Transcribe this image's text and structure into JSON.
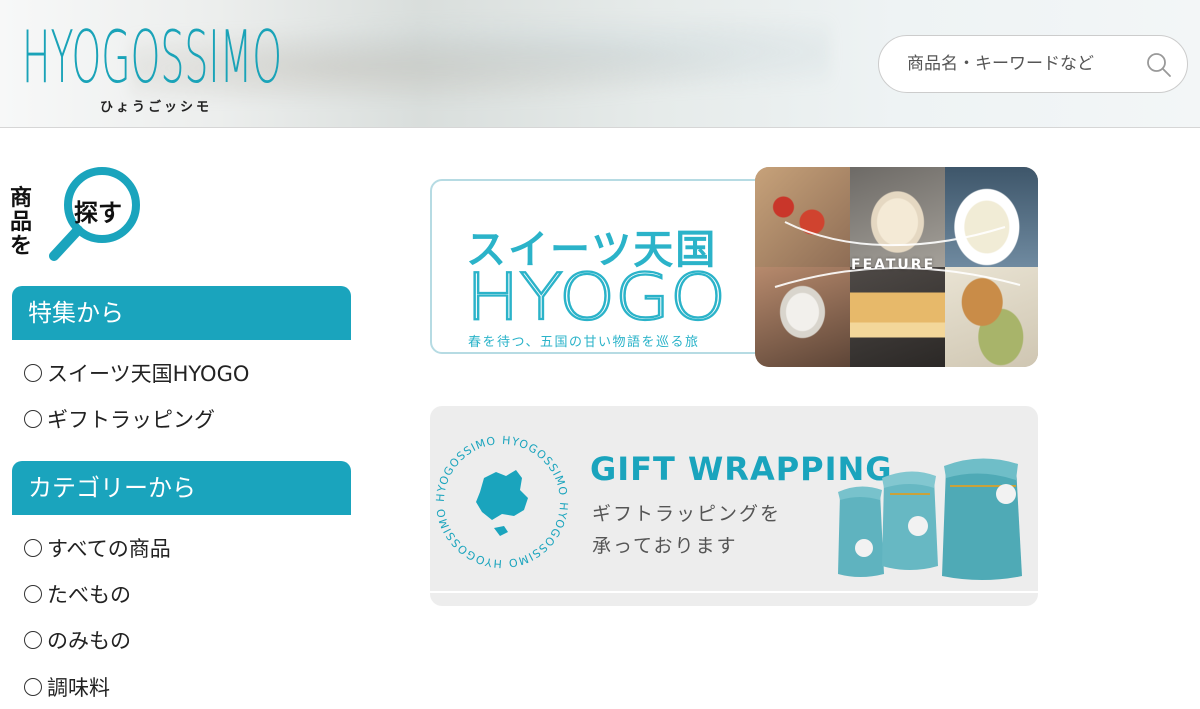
{
  "header": {
    "logo_text": "HYOGOSSIMO",
    "logo_kana": "ひょうごッシモ",
    "search": {
      "placeholder": "商品名・キーワードなど"
    }
  },
  "sidebar": {
    "find_vertical": "商品を",
    "find_lens": "探す",
    "sections": [
      {
        "title": "特集から",
        "items": [
          "スイーツ天国HYOGO",
          "ギフトラッピング"
        ]
      },
      {
        "title": "カテゴリーから",
        "items": [
          "すべての商品",
          "たべもの",
          "のみもの",
          "調味料"
        ]
      }
    ]
  },
  "banners": {
    "sweets": {
      "title_ja": "スイーツ天国",
      "title_en": "HYOGO",
      "subtitle": "春を待つ、五国の甘い物語を巡る旅",
      "feature_label": "FEATURE"
    },
    "gift": {
      "ring_text": "HYOGOSSIMO",
      "title": "GIFT WRAPPING",
      "line1": "ギフトラッピングを",
      "line2": "承っております"
    }
  },
  "colors": {
    "accent": "#1aa4bd",
    "logo": "#1aa3b8"
  }
}
